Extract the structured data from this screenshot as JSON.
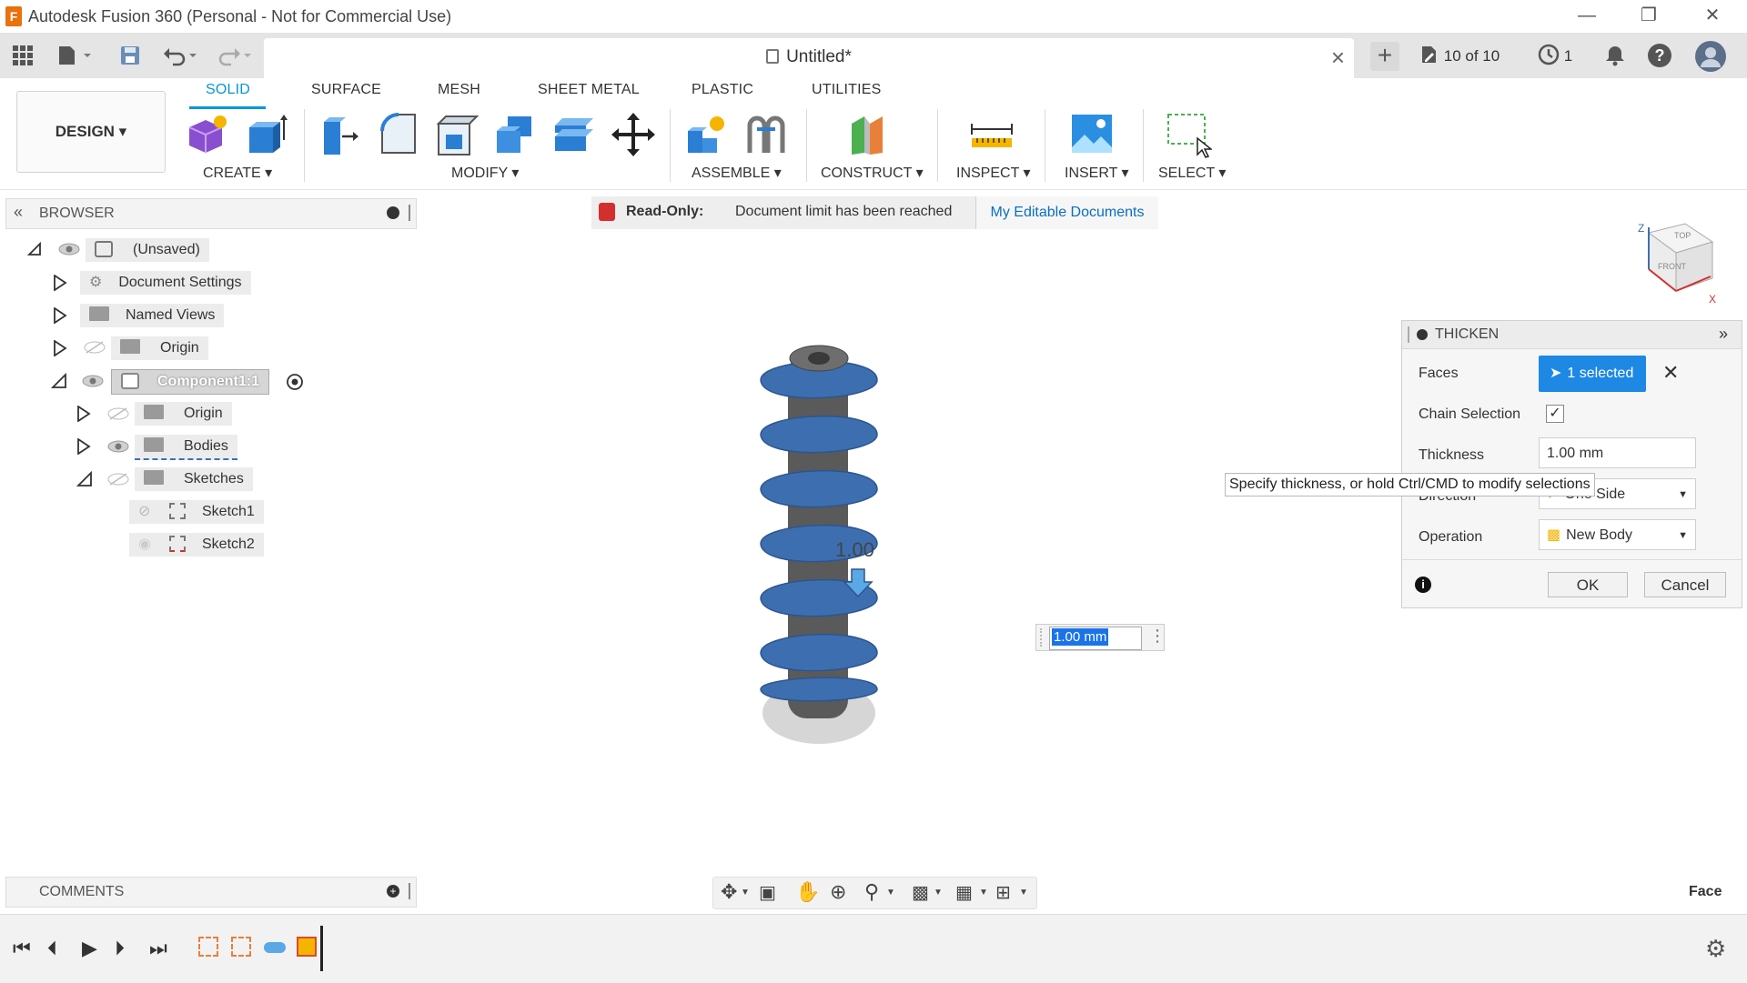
{
  "window": {
    "title": "Autodesk Fusion 360 (Personal - Not for Commercial Use)",
    "app_icon_letter": "F",
    "controls": [
      "minimize",
      "restore",
      "close"
    ]
  },
  "quick_access": {
    "data_panel_icon": "grid-icon",
    "file_icon": "file-icon",
    "save_icon": "save-icon",
    "undo_icon": "undo-icon",
    "redo_icon": "redo-icon"
  },
  "document_tab": {
    "name": "Untitled*",
    "locked": true
  },
  "right_status": {
    "docs_count": "10 of 10",
    "jobs_count": "1"
  },
  "workspace": {
    "label": "DESIGN ▾"
  },
  "tabs": [
    {
      "label": "SOLID",
      "active": true
    },
    {
      "label": "SURFACE",
      "active": false
    },
    {
      "label": "MESH",
      "active": false
    },
    {
      "label": "SHEET METAL",
      "active": false
    },
    {
      "label": "PLASTIC",
      "active": false
    },
    {
      "label": "UTILITIES",
      "active": false
    }
  ],
  "groups": {
    "create": "CREATE ▾",
    "modify": "MODIFY ▾",
    "assemble": "ASSEMBLE ▾",
    "construct": "CONSTRUCT ▾",
    "inspect": "INSPECT ▾",
    "insert": "INSERT ▾",
    "select": "SELECT ▾"
  },
  "browser": {
    "title": "BROWSER",
    "nodes": {
      "root": "(Unsaved)",
      "document_settings": "Document Settings",
      "named_views": "Named Views",
      "origin": "Origin",
      "component": "Component1:1",
      "comp_origin": "Origin",
      "bodies": "Bodies",
      "sketches": "Sketches",
      "sketch1": "Sketch1",
      "sketch2": "Sketch2"
    }
  },
  "banner": {
    "label": "Read-Only:",
    "message": "Document limit has been reached",
    "link": "My Editable Documents"
  },
  "viewcube": {
    "top": "TOP",
    "front": "FRONT",
    "axis_z": "Z",
    "axis_x": "X"
  },
  "model": {
    "dimension_label": "1.00"
  },
  "canvas_input": {
    "value": "1.00 mm"
  },
  "thicken": {
    "title": "THICKEN",
    "faces_label": "Faces",
    "faces_value": "1 selected",
    "chain_label": "Chain Selection",
    "chain_checked": true,
    "thickness_label": "Thickness",
    "thickness_value": "1.00 mm",
    "direction_label": "Direction",
    "direction_value": "One Side",
    "operation_label": "Operation",
    "operation_value": "New Body",
    "ok": "OK",
    "cancel": "Cancel"
  },
  "tooltip": "Specify thickness, or hold Ctrl/CMD to modify selections",
  "comments": {
    "title": "COMMENTS"
  },
  "status": {
    "selection_type": "Face"
  },
  "colors": {
    "accent": "#0696d7",
    "selected_button": "#1e88e5",
    "readonly_lock": "#d32f2f",
    "model_blue": "#3d6fb0",
    "model_grey": "#5a5a5a"
  }
}
